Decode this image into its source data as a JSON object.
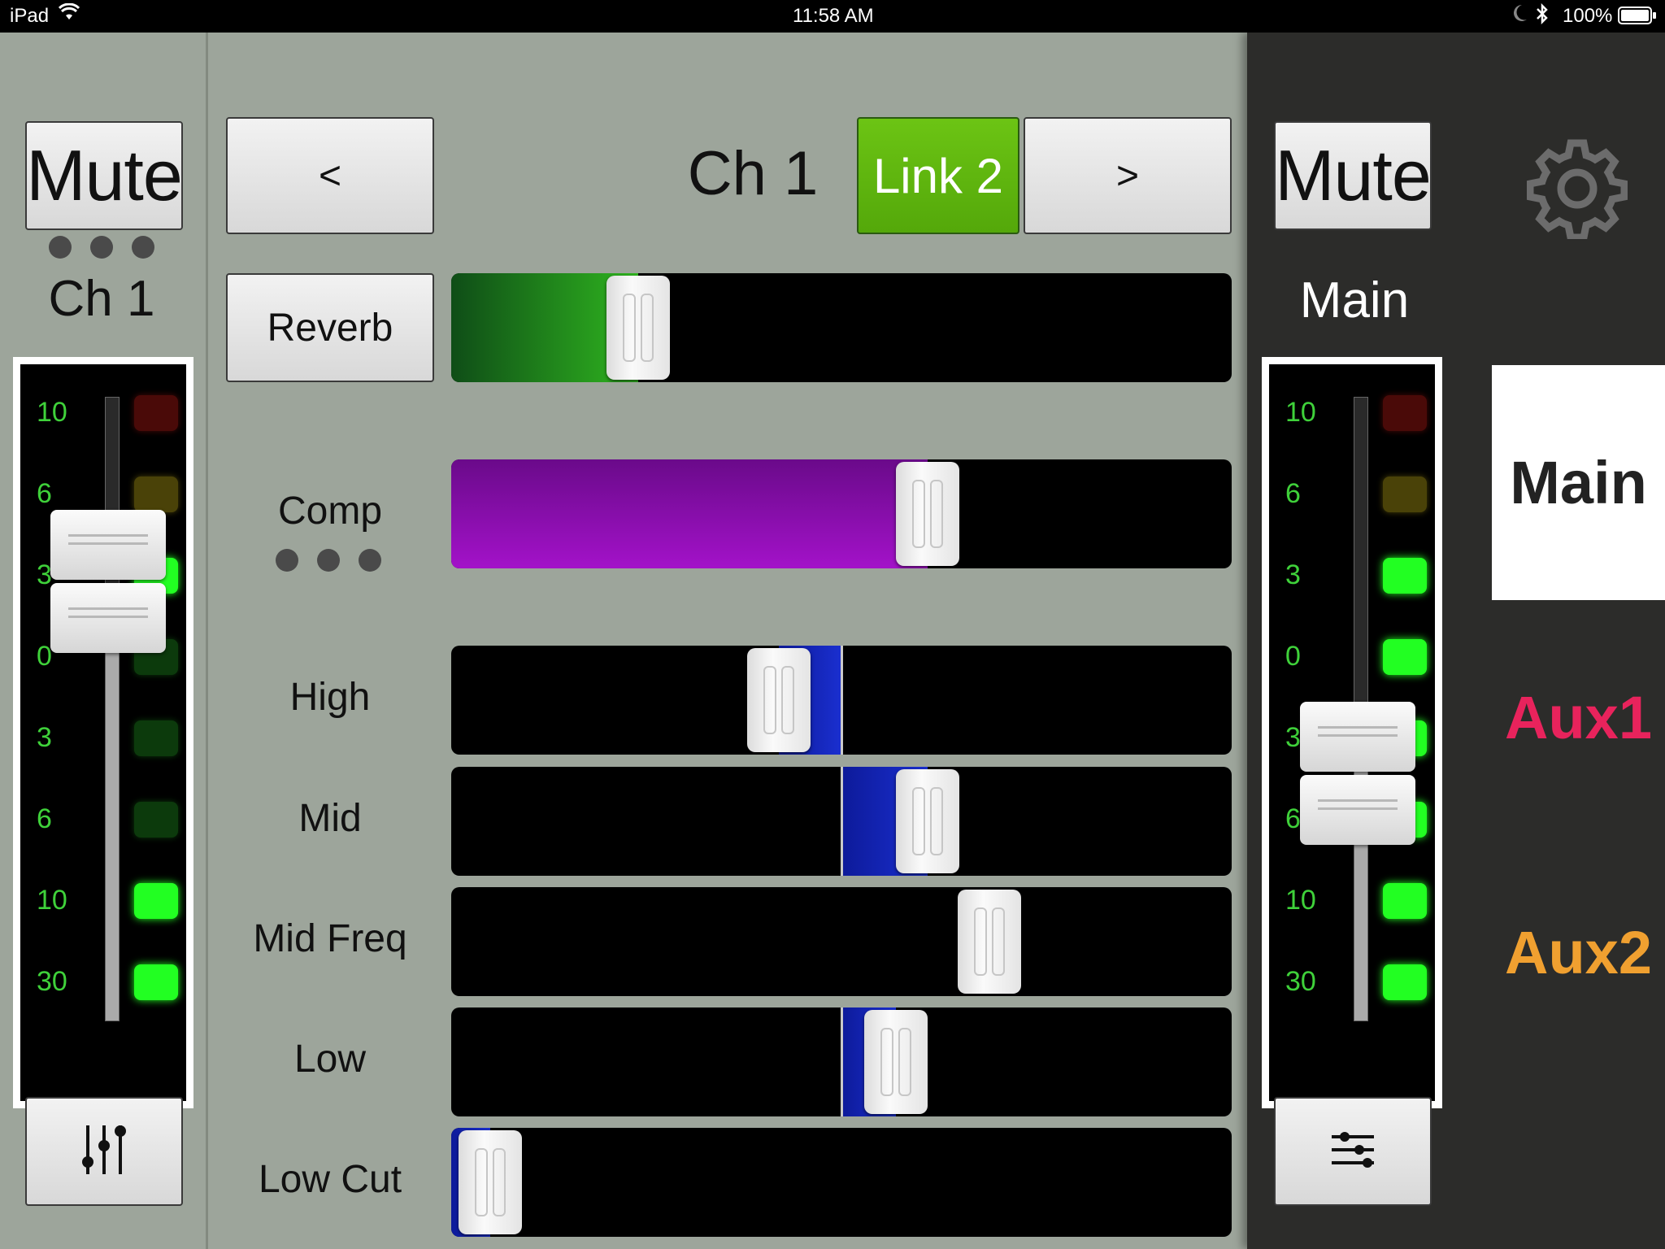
{
  "status_bar": {
    "device": "iPad",
    "time": "11:58 AM",
    "battery": "100%",
    "icons": [
      "wifi-icon",
      "moon-icon",
      "bluetooth-icon",
      "battery-icon"
    ]
  },
  "left_strip": {
    "mute_label": "Mute",
    "channel_label": "Ch 1",
    "meter_scale": [
      "10",
      "6",
      "3",
      "0",
      "3",
      "6",
      "10",
      "30"
    ],
    "leds": [
      "dark-red",
      "dark-yellow",
      "green",
      "dark-green",
      "dark-green",
      "dark-green",
      "green",
      "green"
    ],
    "fader_level": 0.75,
    "bottom_icon": "mixer-sliders-icon"
  },
  "header": {
    "prev_label": "<",
    "channel_title": "Ch 1",
    "link_label": "Link 2",
    "next_label": ">"
  },
  "sliders": [
    {
      "label": "Reverb",
      "type": "button",
      "value": 0.24,
      "style": "fill",
      "color": "#2fb51f"
    },
    {
      "label": "Comp",
      "type": "label",
      "value": 0.61,
      "style": "fill",
      "color": "#a312c9"
    },
    {
      "label": "High",
      "type": "label",
      "value": 0.42,
      "style": "bipolar",
      "color": "#1a2fd0"
    },
    {
      "label": "Mid",
      "type": "label",
      "value": 0.61,
      "style": "bipolar",
      "color": "#1a2fd0"
    },
    {
      "label": "Mid Freq",
      "type": "label",
      "value": 0.69,
      "style": "none",
      "color": "#1a2fd0"
    },
    {
      "label": "Low",
      "type": "label",
      "value": 0.57,
      "style": "bipolar",
      "color": "#1a2fd0"
    },
    {
      "label": "Low Cut",
      "type": "label",
      "value": 0.05,
      "style": "fill",
      "color": "#1a2fd0"
    }
  ],
  "right_panel": {
    "mute_label": "Mute",
    "bus_label": "Main",
    "meter_scale": [
      "10",
      "6",
      "3",
      "0",
      "3",
      "6",
      "10",
      "30"
    ],
    "leds": [
      "dark-red",
      "dark-yellow",
      "green",
      "green",
      "green",
      "green",
      "green",
      "green"
    ],
    "fader_level": 0.43,
    "settings_icon": "gear-icon",
    "bottom_icon": "eq-sliders-icon",
    "buses": [
      {
        "label": "Main",
        "color": "#222222",
        "selected": true
      },
      {
        "label": "Aux1",
        "color": "#e8235c",
        "selected": false
      },
      {
        "label": "Aux2",
        "color": "#f0a030",
        "selected": false
      }
    ]
  }
}
